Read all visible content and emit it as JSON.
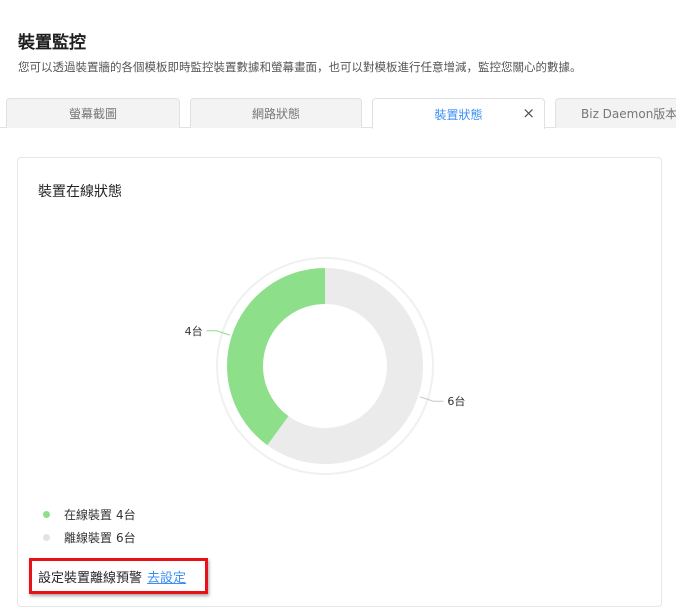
{
  "page": {
    "title": "裝置監控",
    "description": "您可以透過裝置牆的各個模板即時監控裝置數據和螢幕畫面，也可以對模板進行任意增減，監控您關心的數據。"
  },
  "tabs": [
    {
      "label": "螢幕截圖",
      "active": false
    },
    {
      "label": "網路狀態",
      "active": false
    },
    {
      "label": "裝置狀態",
      "active": true,
      "close": "×"
    },
    {
      "label": "Biz Daemon版本&",
      "active": false
    }
  ],
  "card": {
    "title": "裝置在線狀態"
  },
  "chart_data": {
    "type": "pie",
    "donut": true,
    "categories": [
      "在線裝置",
      "離線裝置"
    ],
    "values": [
      4,
      6
    ],
    "data_labels": [
      "4台",
      "6台"
    ],
    "colors": [
      "#8ddf8a",
      "#ebebeb"
    ],
    "legend_position": "bottom-left"
  },
  "legend": [
    {
      "label": "在線裝置",
      "value": "4台",
      "color": "#8ddf8a"
    },
    {
      "label": "離線裝置",
      "value": "6台",
      "color": "#e3e3e3"
    }
  ],
  "alert": {
    "text": "設定裝置離線預警",
    "link": "去設定"
  },
  "colors": {
    "accent": "#3b8ff5",
    "highlight_border": "#e8111a"
  }
}
